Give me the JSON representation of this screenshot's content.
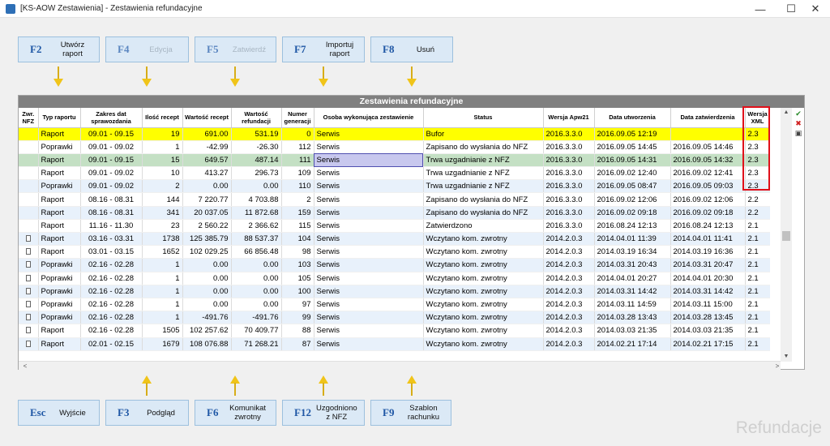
{
  "window": {
    "title": "[KS-AOW Zestawienia] - Zestawienia refundacyjne",
    "minimize": "—",
    "maximize": "☐",
    "close": "✕"
  },
  "top_keys": [
    {
      "key": "F2",
      "label": "Utwórz raport",
      "enabled": true
    },
    {
      "key": "F4",
      "label": "Edycja",
      "enabled": false
    },
    {
      "key": "F5",
      "label": "Zatwierdź",
      "enabled": false
    },
    {
      "key": "F7",
      "label": "Importuj raport",
      "enabled": true
    },
    {
      "key": "F8",
      "label": "Usuń",
      "enabled": true
    }
  ],
  "bottom_keys": [
    {
      "key": "Esc",
      "label": "Wyjście"
    },
    {
      "key": "F3",
      "label": "Podgląd"
    },
    {
      "key": "F6",
      "label": "Komunikat zwrotny"
    },
    {
      "key": "F12",
      "label": "Uzgodniono z NFZ"
    },
    {
      "key": "F9",
      "label": "Szablon rachunku"
    }
  ],
  "grid": {
    "title": "Zestawienia refundacyjne",
    "columns": [
      "Zwr. NFZ",
      "Typ raportu",
      "Zakres dat sprawozdania",
      "Ilość recept",
      "Wartość recept",
      "Wartość refundacji",
      "Numer generacji",
      "Osoba wykonująca zestawienie",
      "Status",
      "Wersja Apw21",
      "Data utworzenia",
      "Data zatwierdzenia",
      "Wersja XML"
    ],
    "rows": [
      {
        "icon": false,
        "typ": "Raport",
        "zakres": "09.01 - 09.15",
        "ilosc": "19",
        "wartosc": "691.00",
        "refundacja": "531.19",
        "numer": "0",
        "osoba": "Serwis",
        "status": "Bufor",
        "wersja": "2016.3.3.0",
        "utworzenia": "2016.09.05 12:19",
        "zatwierdzenia": "",
        "xml": "2.3",
        "style": "highlight"
      },
      {
        "icon": false,
        "typ": "Poprawki",
        "zakres": "09.01 - 09.02",
        "ilosc": "1",
        "wartosc": "-42.99",
        "refundacja": "-26.30",
        "numer": "112",
        "osoba": "Serwis",
        "status": "Zapisano do wysłania do NFZ",
        "wersja": "2016.3.3.0",
        "utworzenia": "2016.09.05 14:45",
        "zatwierdzenia": "2016.09.05 14:46",
        "xml": "2.3",
        "style": "odd"
      },
      {
        "icon": false,
        "typ": "Raport",
        "zakres": "09.01 - 09.15",
        "ilosc": "15",
        "wartosc": "649.57",
        "refundacja": "487.14",
        "numer": "111",
        "osoba": "Serwis",
        "status": "Trwa uzgadnianie z NFZ",
        "wersja": "2016.3.3.0",
        "utworzenia": "2016.09.05 14:31",
        "zatwierdzenia": "2016.09.05 14:32",
        "xml": "2.3",
        "style": "selected"
      },
      {
        "icon": false,
        "typ": "Raport",
        "zakres": "09.01 - 09.02",
        "ilosc": "10",
        "wartosc": "413.27",
        "refundacja": "296.73",
        "numer": "109",
        "osoba": "Serwis",
        "status": "Trwa uzgadnianie z NFZ",
        "wersja": "2016.3.3.0",
        "utworzenia": "2016.09.02 12:40",
        "zatwierdzenia": "2016.09.02 12:41",
        "xml": "2.3",
        "style": "odd"
      },
      {
        "icon": false,
        "typ": "Poprawki",
        "zakres": "09.01 - 09.02",
        "ilosc": "2",
        "wartosc": "0.00",
        "refundacja": "0.00",
        "numer": "110",
        "osoba": "Serwis",
        "status": "Trwa uzgadnianie z NFZ",
        "wersja": "2016.3.3.0",
        "utworzenia": "2016.09.05 08:47",
        "zatwierdzenia": "2016.09.05 09:03",
        "xml": "2.3",
        "style": "even"
      },
      {
        "icon": false,
        "typ": "Raport",
        "zakres": "08.16 - 08.31",
        "ilosc": "144",
        "wartosc": "7 220.77",
        "refundacja": "4 703.88",
        "numer": "2",
        "osoba": "Serwis",
        "status": "Zapisano do wysłania do NFZ",
        "wersja": "2016.3.3.0",
        "utworzenia": "2016.09.02 12:06",
        "zatwierdzenia": "2016.09.02 12:06",
        "xml": "2.2",
        "style": "odd"
      },
      {
        "icon": false,
        "typ": "Raport",
        "zakres": "08.16 - 08.31",
        "ilosc": "341",
        "wartosc": "20 037.05",
        "refundacja": "11 872.68",
        "numer": "159",
        "osoba": "Serwis",
        "status": "Zapisano do wysłania do NFZ",
        "wersja": "2016.3.3.0",
        "utworzenia": "2016.09.02 09:18",
        "zatwierdzenia": "2016.09.02 09:18",
        "xml": "2.2",
        "style": "even"
      },
      {
        "icon": false,
        "typ": "Raport",
        "zakres": "11.16 - 11.30",
        "ilosc": "23",
        "wartosc": "2 560.22",
        "refundacja": "2 366.62",
        "numer": "115",
        "osoba": "Serwis",
        "status": "Zatwierdzono",
        "wersja": "2016.3.3.0",
        "utworzenia": "2016.08.24 12:13",
        "zatwierdzenia": "2016.08.24 12:13",
        "xml": "2.1",
        "style": "odd"
      },
      {
        "icon": true,
        "typ": "Raport",
        "zakres": "03.16 - 03.31",
        "ilosc": "1738",
        "wartosc": "125 385.79",
        "refundacja": "88 537.37",
        "numer": "104",
        "osoba": "Serwis",
        "status": "Wczytano kom. zwrotny",
        "wersja": "2014.2.0.3",
        "utworzenia": "2014.04.01 11:39",
        "zatwierdzenia": "2014.04.01 11:41",
        "xml": "2.1",
        "style": "even"
      },
      {
        "icon": true,
        "typ": "Raport",
        "zakres": "03.01 - 03.15",
        "ilosc": "1652",
        "wartosc": "102 029.25",
        "refundacja": "66 856.48",
        "numer": "98",
        "osoba": "Serwis",
        "status": "Wczytano kom. zwrotny",
        "wersja": "2014.2.0.3",
        "utworzenia": "2014.03.19 16:34",
        "zatwierdzenia": "2014.03.19 16:36",
        "xml": "2.1",
        "style": "odd"
      },
      {
        "icon": true,
        "typ": "Poprawki",
        "zakres": "02.16 - 02.28",
        "ilosc": "1",
        "wartosc": "0.00",
        "refundacja": "0.00",
        "numer": "103",
        "osoba": "Serwis",
        "status": "Wczytano kom. zwrotny",
        "wersja": "2014.2.0.3",
        "utworzenia": "2014.03.31 20:43",
        "zatwierdzenia": "2014.03.31 20:47",
        "xml": "2.1",
        "style": "even"
      },
      {
        "icon": true,
        "typ": "Poprawki",
        "zakres": "02.16 - 02.28",
        "ilosc": "1",
        "wartosc": "0.00",
        "refundacja": "0.00",
        "numer": "105",
        "osoba": "Serwis",
        "status": "Wczytano kom. zwrotny",
        "wersja": "2014.2.0.3",
        "utworzenia": "2014.04.01 20:27",
        "zatwierdzenia": "2014.04.01 20:30",
        "xml": "2.1",
        "style": "odd"
      },
      {
        "icon": true,
        "typ": "Poprawki",
        "zakres": "02.16 - 02.28",
        "ilosc": "1",
        "wartosc": "0.00",
        "refundacja": "0.00",
        "numer": "100",
        "osoba": "Serwis",
        "status": "Wczytano kom. zwrotny",
        "wersja": "2014.2.0.3",
        "utworzenia": "2014.03.31 14:42",
        "zatwierdzenia": "2014.03.31 14:42",
        "xml": "2.1",
        "style": "even"
      },
      {
        "icon": true,
        "typ": "Poprawki",
        "zakres": "02.16 - 02.28",
        "ilosc": "1",
        "wartosc": "0.00",
        "refundacja": "0.00",
        "numer": "97",
        "osoba": "Serwis",
        "status": "Wczytano kom. zwrotny",
        "wersja": "2014.2.0.3",
        "utworzenia": "2014.03.11 14:59",
        "zatwierdzenia": "2014.03.11 15:00",
        "xml": "2.1",
        "style": "odd"
      },
      {
        "icon": true,
        "typ": "Poprawki",
        "zakres": "02.16 - 02.28",
        "ilosc": "1",
        "wartosc": "-491.76",
        "refundacja": "-491.76",
        "numer": "99",
        "osoba": "Serwis",
        "status": "Wczytano kom. zwrotny",
        "wersja": "2014.2.0.3",
        "utworzenia": "2014.03.28 13:43",
        "zatwierdzenia": "2014.03.28 13:45",
        "xml": "2.1",
        "style": "even"
      },
      {
        "icon": true,
        "typ": "Raport",
        "zakres": "02.16 - 02.28",
        "ilosc": "1505",
        "wartosc": "102 257.62",
        "refundacja": "70 409.77",
        "numer": "88",
        "osoba": "Serwis",
        "status": "Wczytano kom. zwrotny",
        "wersja": "2014.2.0.3",
        "utworzenia": "2014.03.03 21:35",
        "zatwierdzenia": "2014.03.03 21:35",
        "xml": "2.1",
        "style": "odd"
      },
      {
        "icon": true,
        "typ": "Raport",
        "zakres": "02.01 - 02.15",
        "ilosc": "1679",
        "wartosc": "108 076.88",
        "refundacja": "71 268.21",
        "numer": "87",
        "osoba": "Serwis",
        "status": "Wczytano kom. zwrotny",
        "wersja": "2014.2.0.3",
        "utworzenia": "2014.02.21 17:14",
        "zatwierdzenia": "2014.02.21 17:15",
        "xml": "2.1",
        "style": "even"
      }
    ]
  },
  "icons": {
    "doc": "document-icon",
    "tool_accept": "✔",
    "tool_delete": "✖",
    "tool_window": "▣"
  },
  "watermark": "Refundacje"
}
